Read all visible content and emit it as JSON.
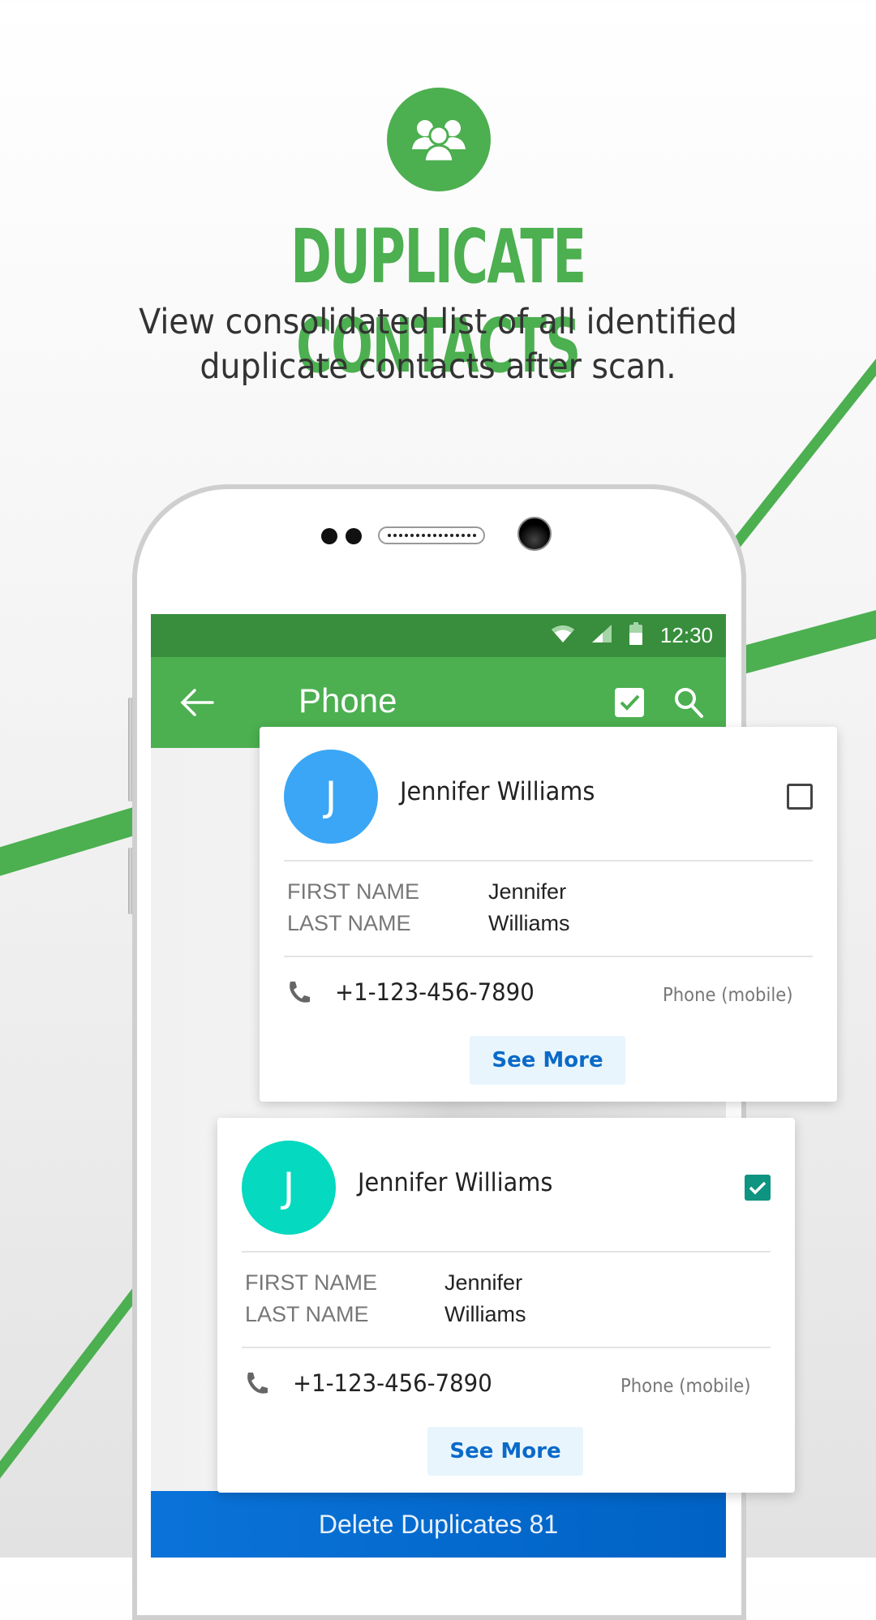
{
  "hero": {
    "icon": "group-people-icon",
    "title": "DUPLICATE CONTACTS",
    "subtitle_line1": "View consolidated list of all identified",
    "subtitle_line2": "duplicate contacts after scan."
  },
  "colors": {
    "brand_green": "#4CAF50",
    "status_green": "#388E3C",
    "avatar_blue": "#3aa6f5",
    "avatar_teal": "#05d9bf",
    "checkbox_teal": "#0e9480",
    "action_blue": "#0069c9",
    "see_more_text": "#0a6ac8"
  },
  "status_bar": {
    "icons": [
      "wifi-icon",
      "signal-icon",
      "battery-icon"
    ],
    "time": "12:30"
  },
  "toolbar": {
    "back_icon": "arrow-left-icon",
    "title": "Phone",
    "select_all_icon": "checkbox-checked-icon",
    "search_icon": "search-icon"
  },
  "contacts": [
    {
      "initial": "J",
      "name": "Jennifer Williams",
      "checked": false,
      "fields": [
        {
          "label": "FIRST NAME",
          "value": "Jennifer"
        },
        {
          "label": "LAST NAME",
          "value": "Williams"
        }
      ],
      "phone": "+1-123-456-7890",
      "phone_type": "Phone (mobile)",
      "see_more": "See More"
    },
    {
      "initial": "J",
      "name": "Jennifer Williams",
      "checked": true,
      "fields": [
        {
          "label": "FIRST NAME",
          "value": "Jennifer"
        },
        {
          "label": "LAST NAME",
          "value": "Williams"
        }
      ],
      "phone": "+1-123-456-7890",
      "phone_type": "Phone (mobile)",
      "see_more": "See More"
    }
  ],
  "delete_button": {
    "label": "Delete Duplicates 81"
  }
}
